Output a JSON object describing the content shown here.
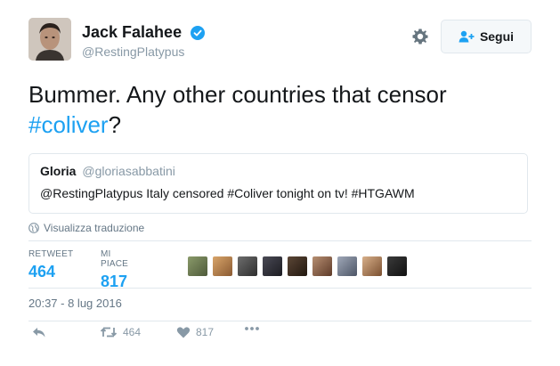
{
  "author": {
    "display_name": "Jack Falahee",
    "handle": "@RestingPlatypus",
    "verified": true
  },
  "follow_button": {
    "label": "Segui"
  },
  "tweet": {
    "text_prefix": "Bummer. Any other countries that censor",
    "hashtag": "#coliver",
    "text_suffix": "?"
  },
  "quoted_tweet": {
    "name": "Gloria",
    "handle": "@gloriasabbatini",
    "text": "@RestingPlatypus Italy censored #Coliver tonight on tv! #HTGAWM"
  },
  "translate_link": "Visualizza traduzione",
  "stats": {
    "retweets_label": "RETWEET",
    "retweets_value": "464",
    "likes_label": "MI PIACE",
    "likes_value": "817"
  },
  "timestamp": "20:37 - 8 lug 2016",
  "actions": {
    "retweet_count": "464",
    "like_count": "817"
  },
  "colors": {
    "accent": "#1da1f2",
    "muted": "#8899a6",
    "border": "#e1e8ed"
  },
  "icons": [
    "verified-badge-icon",
    "gear-icon",
    "follow-person-icon",
    "globe-icon",
    "reply-icon",
    "retweet-icon",
    "heart-icon",
    "more-icon"
  ]
}
